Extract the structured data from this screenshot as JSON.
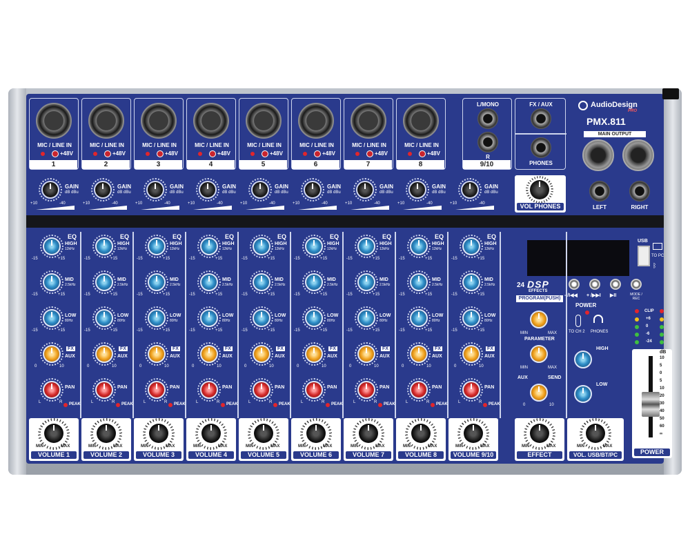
{
  "brand": {
    "name": "AudioDesign",
    "sub": "PRO",
    "model": "PMX.811"
  },
  "mono_channels": [
    {
      "number": "1",
      "input_label": "MIC / LINE  IN",
      "phantom": "+48V"
    },
    {
      "number": "2",
      "input_label": "MIC / LINE  IN",
      "phantom": "+48V"
    },
    {
      "number": "3",
      "input_label": "MIC / LINE  IN",
      "phantom": "+48V"
    },
    {
      "number": "4",
      "input_label": "MIC / LINE  IN",
      "phantom": "+48V"
    },
    {
      "number": "5",
      "input_label": "MIC / LINE  IN",
      "phantom": "+48V"
    },
    {
      "number": "6",
      "input_label": "MIC / LINE  IN",
      "phantom": "+48V"
    },
    {
      "number": "7",
      "input_label": "MIC / LINE  IN",
      "phantom": "+48V"
    },
    {
      "number": "8",
      "input_label": "MIC / LINE  IN",
      "phantom": "+48V"
    }
  ],
  "stereo_channel": {
    "number": "9/10",
    "top_label": "L/MONO",
    "bottom_label": "R"
  },
  "fx_aux": {
    "top_label": "FX / AUX",
    "bottom_label": "PHONES"
  },
  "main_output": {
    "label": "MAIN OUTPUT",
    "left": "LEFT",
    "right": "RIGHT"
  },
  "gain": {
    "label": "GAIN",
    "unit": "dB dBu",
    "min": "+10",
    "max": "-40"
  },
  "vol_phones": "VOL PHONES",
  "eq": {
    "title": "EQ",
    "high": {
      "label": "HIGH",
      "freq": "12kHz"
    },
    "mid": {
      "label": "MID",
      "freq": "2.5kHz"
    },
    "low": {
      "label": "LOW",
      "freq": "80Hz"
    },
    "min": "-15",
    "max": "+15"
  },
  "fx_send": {
    "label_a": "FX",
    "label_b": "AUX",
    "min": "0",
    "max": "10"
  },
  "pan": {
    "label": "PAN",
    "left": "L",
    "right": "R",
    "peak": "PEAK"
  },
  "volume_labels": [
    "VOLUME 1",
    "VOLUME 2",
    "VOLUME 3",
    "VOLUME 4",
    "VOLUME 5",
    "VOLUME 6",
    "VOLUME 7",
    "VOLUME 8",
    "VOLUME 9/10"
  ],
  "vol_min": "MIN",
  "vol_max": "MAX",
  "dsp": {
    "count": "24",
    "name": "DSP",
    "sub": "EFFECTS",
    "program": "PROGRAM(PUSH)",
    "parameter": "PARAMETER",
    "aux": "AUX",
    "send": "SEND",
    "min": "MIN",
    "max": "MAX",
    "zero": "0",
    "ten": "10"
  },
  "effect_label": "EFFECT",
  "usb_label": "VOL. USB/BT/PC",
  "usb": {
    "label": "USB",
    "to_pc": "TO PC"
  },
  "player": {
    "prev": "- /I◀◀",
    "next": "+ /▶▶I",
    "play": "▶II",
    "mode": "MODE / REC"
  },
  "power_label": "POWER",
  "to_ch2": "TO CH 2",
  "phones_small": "PHONES",
  "master_eq": {
    "high": "HIGH",
    "low": "LOW"
  },
  "meter": {
    "clip": "CLIP",
    "levels": [
      "+6",
      "0",
      "-6",
      "-24"
    ]
  },
  "fader": {
    "unit": "dB",
    "scale": [
      "10",
      "5",
      "0",
      "5",
      "10",
      "20",
      "30",
      "40",
      "50",
      "60",
      "∞"
    ],
    "label": "POWER"
  }
}
